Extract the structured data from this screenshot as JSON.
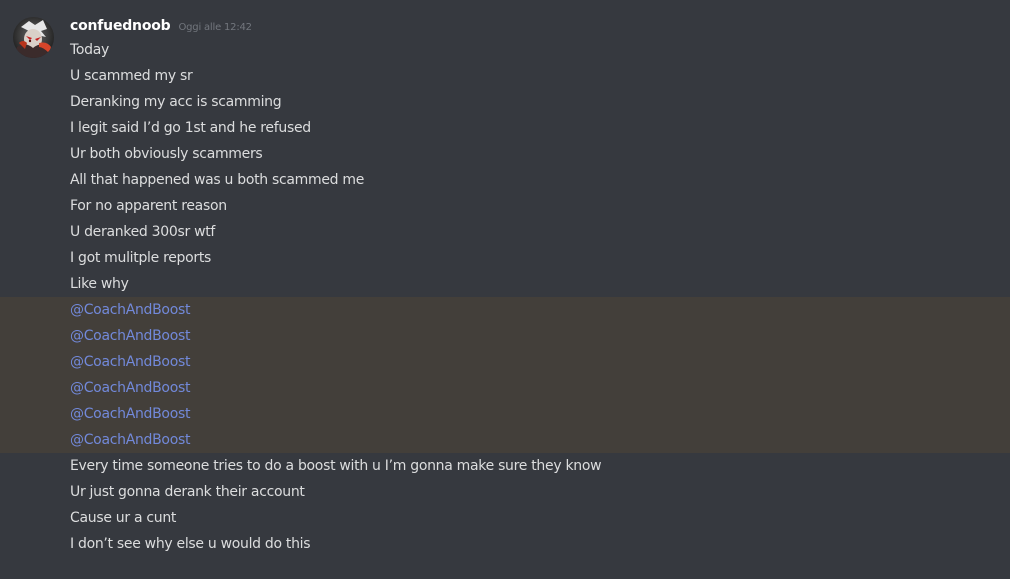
{
  "message": {
    "username": "confuednoob",
    "timestamp": "Oggi alle 12:42",
    "lines": [
      {
        "text": "Today",
        "mention": false
      },
      {
        "text": "U scammed my sr",
        "mention": false
      },
      {
        "text": "Deranking my acc is scamming",
        "mention": false
      },
      {
        "text": "I legit said I’d go 1st and he refused",
        "mention": false
      },
      {
        "text": "Ur both obviously scammers",
        "mention": false
      },
      {
        "text": "All that happened was u both scammed me",
        "mention": false
      },
      {
        "text": "For no apparent reason",
        "mention": false
      },
      {
        "text": "U deranked 300sr wtf",
        "mention": false
      },
      {
        "text": "I got mulitple reports",
        "mention": false
      },
      {
        "text": "Like why",
        "mention": false
      },
      {
        "text": "@CoachAndBoost",
        "mention": true
      },
      {
        "text": "@CoachAndBoost",
        "mention": true
      },
      {
        "text": "@CoachAndBoost",
        "mention": true
      },
      {
        "text": "@CoachAndBoost",
        "mention": true
      },
      {
        "text": "@CoachAndBoost",
        "mention": true
      },
      {
        "text": "@CoachAndBoost",
        "mention": true
      },
      {
        "text": "Every time someone tries to do a boost with u I’m gonna make sure they know",
        "mention": false
      },
      {
        "text": "Ur just gonna derank their account",
        "mention": false
      },
      {
        "text": "Cause ur a cunt",
        "mention": false
      },
      {
        "text": "I don’t see why else u would do this",
        "mention": false
      }
    ]
  },
  "colors": {
    "background": "#36393f",
    "username": "#ffffff",
    "timestamp": "#72767d",
    "text": "#dcddde",
    "mention_text": "#7289da",
    "mention_highlight": "#433f3a"
  },
  "avatar_icon": "avatar-icon"
}
